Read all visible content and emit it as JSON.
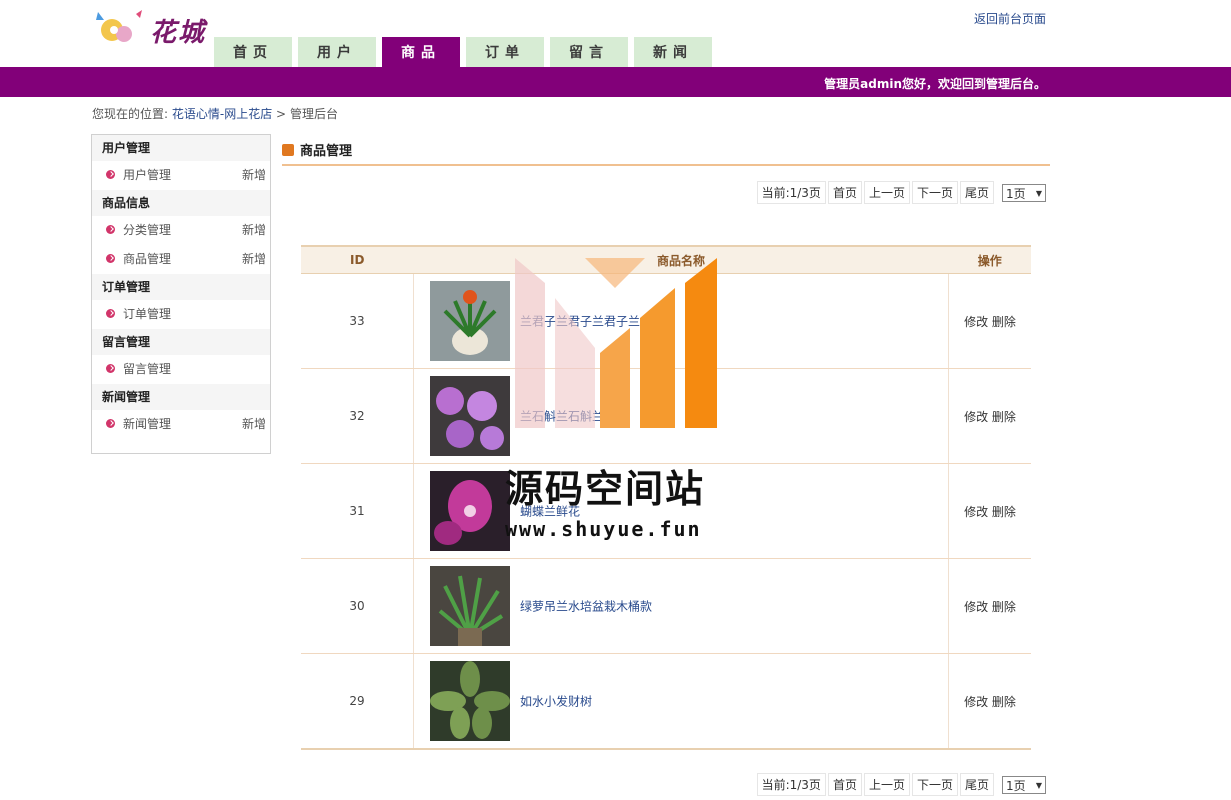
{
  "header": {
    "logo_text": "花城",
    "back_link": "返回前台页面",
    "nav": [
      "首页",
      "用户",
      "商品",
      "订单",
      "留言",
      "新闻"
    ],
    "active_tab": "商品",
    "welcome": "管理员admin您好，欢迎回到管理后台。"
  },
  "breadcrumb": {
    "prefix": "您现在的位置:",
    "site": "花语心情-网上花店",
    "sep": ">",
    "current": "管理后台"
  },
  "sidebar": {
    "groups": [
      {
        "title": "用户管理",
        "items": [
          {
            "label": "用户管理",
            "add": "新增"
          }
        ]
      },
      {
        "title": "商品信息",
        "items": [
          {
            "label": "分类管理",
            "add": "新增"
          },
          {
            "label": "商品管理",
            "add": "新增"
          }
        ]
      },
      {
        "title": "订单管理",
        "items": [
          {
            "label": "订单管理",
            "add": ""
          }
        ]
      },
      {
        "title": "留言管理",
        "items": [
          {
            "label": "留言管理",
            "add": ""
          }
        ]
      },
      {
        "title": "新闻管理",
        "items": [
          {
            "label": "新闻管理",
            "add": "新增"
          }
        ]
      }
    ]
  },
  "main": {
    "title": "商品管理",
    "pager": {
      "current": "当前:1/3页",
      "first": "首页",
      "prev": "上一页",
      "next": "下一页",
      "last": "尾页",
      "select": "1页"
    },
    "columns": [
      "ID",
      "商品名称",
      "操作"
    ],
    "rows": [
      {
        "id": "33",
        "name": "兰君子兰君子兰君子兰",
        "edit": "修改",
        "delete": "删除"
      },
      {
        "id": "32",
        "name": "兰石斛兰石斛兰石斛",
        "edit": "修改",
        "delete": "删除"
      },
      {
        "id": "31",
        "name": "蝴蝶兰鲜花",
        "edit": "修改",
        "delete": "删除"
      },
      {
        "id": "30",
        "name": "绿萝吊兰水培盆栽木桶款",
        "edit": "修改",
        "delete": "删除"
      },
      {
        "id": "29",
        "name": "如水小发财树",
        "edit": "修改",
        "delete": "删除"
      }
    ]
  },
  "watermark": {
    "title": "源码空间站",
    "url": "www.shuyue.fun"
  },
  "colors": {
    "brand": "#820079",
    "nav_tab": "#d7ecd4",
    "link": "#2a4b8d",
    "accent": "#e07820"
  }
}
